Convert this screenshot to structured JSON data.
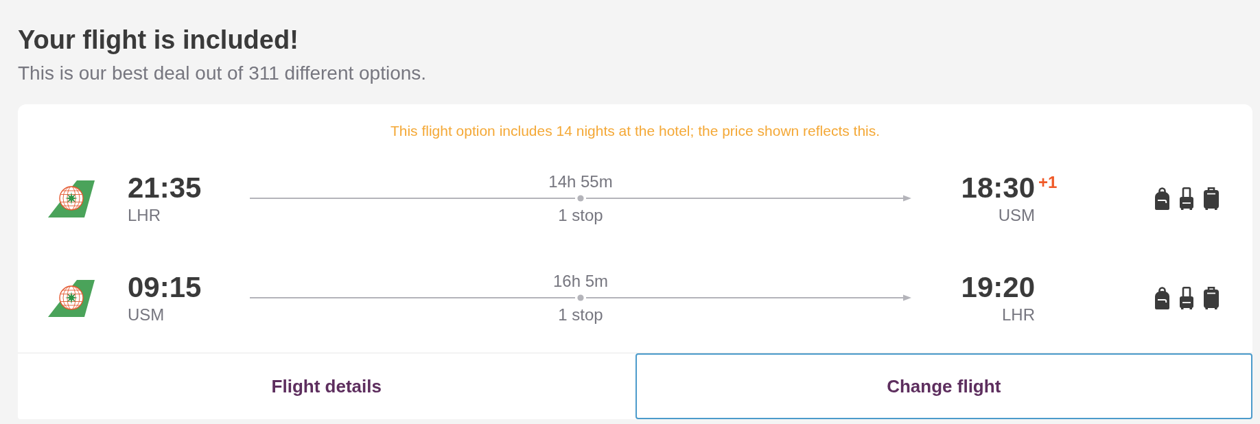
{
  "header": {
    "title": "Your flight is included!",
    "subtitle": "This is our best deal out of 311 different options."
  },
  "card": {
    "notice": "This flight option includes 14 nights at the hotel; the price shown reflects this.",
    "legs": [
      {
        "departure": {
          "time": "21:35",
          "airport": "LHR"
        },
        "duration": "14h 55m",
        "stops": "1 stop",
        "arrival": {
          "time": "18:30",
          "day_offset": "+1",
          "airport": "USM"
        },
        "baggage": [
          {
            "kind": "personal",
            "included": true
          },
          {
            "kind": "cabin",
            "included": true
          },
          {
            "kind": "checked",
            "included": true
          }
        ]
      },
      {
        "departure": {
          "time": "09:15",
          "airport": "USM"
        },
        "duration": "16h 5m",
        "stops": "1 stop",
        "arrival": {
          "time": "19:20",
          "airport": "LHR"
        },
        "baggage": [
          {
            "kind": "personal",
            "included": true
          },
          {
            "kind": "cabin",
            "included": true
          },
          {
            "kind": "checked",
            "included": true
          }
        ]
      }
    ],
    "buttons": [
      {
        "label": "Flight details",
        "focused": false
      },
      {
        "label": "Change flight",
        "focused": true
      }
    ]
  }
}
